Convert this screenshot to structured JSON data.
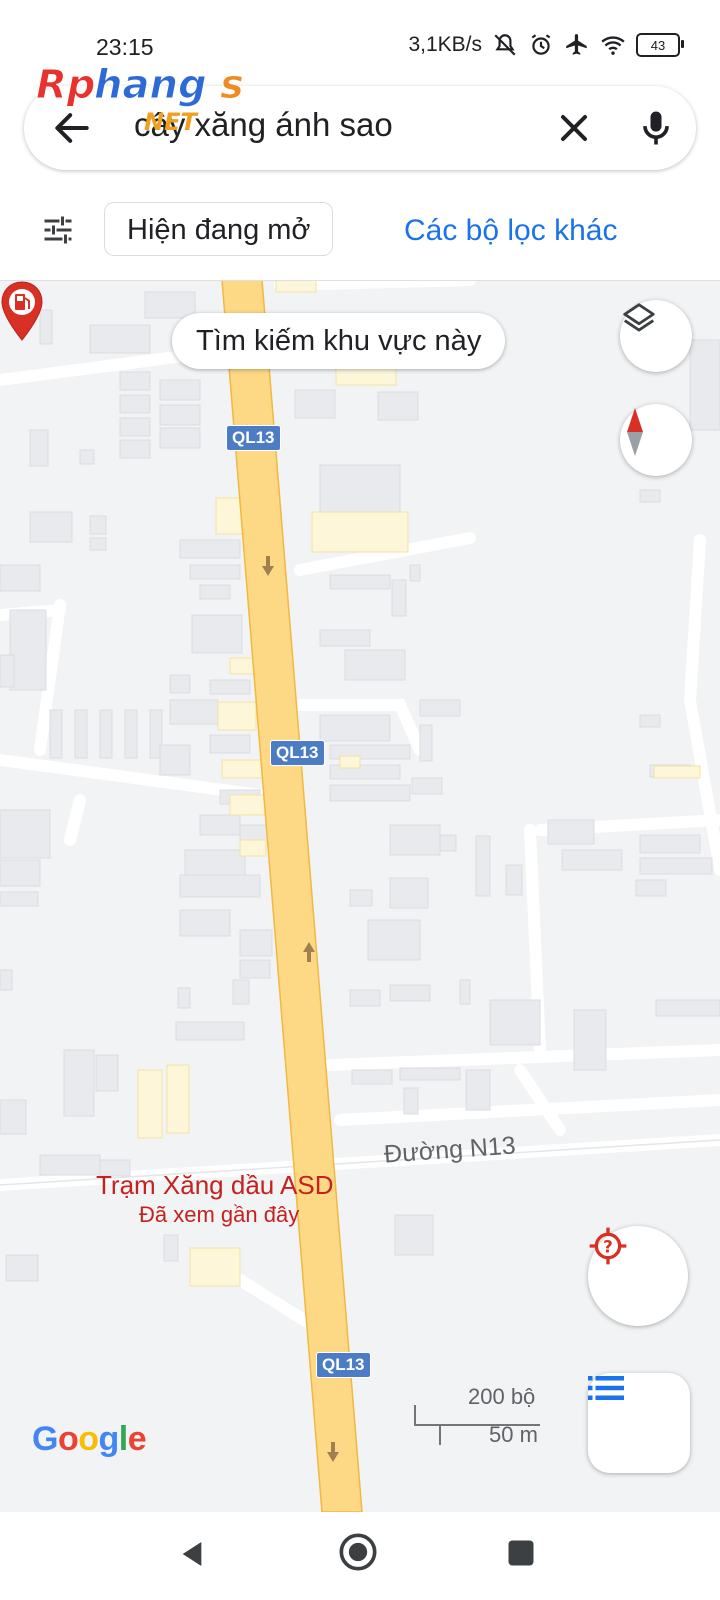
{
  "status_bar": {
    "time": "23:15",
    "network_speed": "3,1KB/s",
    "battery": "43",
    "icons": [
      "mute-icon",
      "alarm-icon",
      "airplane-icon",
      "wifi-icon",
      "battery-icon"
    ]
  },
  "watermark": {
    "text": "Rphangs",
    "sub": "NET"
  },
  "search": {
    "query": "cây xăng ánh sao"
  },
  "filters": {
    "open_now": "Hiện đang mở",
    "more_filters": "Các bộ lọc khác"
  },
  "map": {
    "search_area": "Tìm kiếm khu vực này",
    "road_labels": [
      "QL13",
      "QL13",
      "QL13"
    ],
    "street_name": "Đường N13",
    "place": {
      "name": "Trạm Xăng dầu ASD",
      "status": "Đã xem gần đây"
    },
    "scale": {
      "feet": "200 bộ",
      "meters": "50 m"
    },
    "attribution": "Google"
  },
  "colors": {
    "accent": "#1a73e8",
    "highway": "#fdd985",
    "place_red": "#c5221f",
    "map_bg": "#f1f3f4"
  }
}
